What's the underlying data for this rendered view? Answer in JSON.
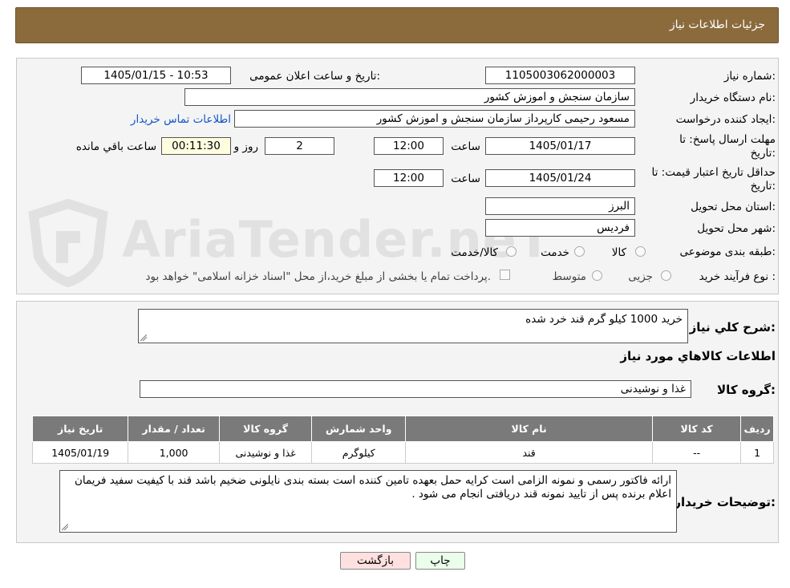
{
  "header": {
    "title": "جزئیات اطلاعات نیاز"
  },
  "form": {
    "need_number_label": "شماره نیاز:",
    "need_number": "1105003062000003",
    "announce_label": "تاریخ و ساعت اعلان عمومی:",
    "announce_value": "1405/01/15 - 10:53",
    "buyer_label": "نام دستگاه خریدار:",
    "buyer_value": "سازمان سنجش و اموزش کشور",
    "creator_label": "ایجاد کننده درخواست:",
    "creator_value": "مسعود رحیمی کارپرداز سازمان سنجش و اموزش کشور",
    "contact_link": "اطلاعات تماس خریدار",
    "deadline_label_1": "مهلت ارسال پاسخ: تا",
    "deadline_label_2": "تاریخ:",
    "deadline_date": "1405/01/17",
    "time_word": "ساعت",
    "deadline_time": "12:00",
    "days_value": "2",
    "days_word": "روز و",
    "remaining_time": "00:11:30",
    "remaining_word": "ساعت باقي مانده",
    "validity_label_1": "حداقل تاریخ اعتبار قیمت: تا",
    "validity_label_2": "تاریخ:",
    "validity_date": "1405/01/24",
    "validity_time": "12:00",
    "province_label": "استان محل تحویل:",
    "province_value": "البرز",
    "city_label": "شهر محل تحویل:",
    "city_value": "فردیس",
    "category_label": "طبقه بندی موضوعی:",
    "category_options": [
      "کالا",
      "خدمت",
      "کالا/خدمت"
    ],
    "process_label": "نوع فرآیند خرید :",
    "process_options": [
      "جزیی",
      "متوسط"
    ],
    "payment_note": "پرداخت تمام یا بخشی از مبلغ خرید،از محل \"اسناد خزانه اسلامی\" خواهد بود."
  },
  "description": {
    "label": "شرح کلي نياز:",
    "value": "خرید 1000 کیلو گرم قند خرد شده"
  },
  "goods_info": {
    "heading": "اطلاعات کالاهاي مورد نياز",
    "group_label": "گروه کالا:",
    "group_value": "غذا و نوشیدنی"
  },
  "table": {
    "headers": [
      "رديف",
      "کد کالا",
      "نام کالا",
      "واحد شمارش",
      "گروه کالا",
      "تعداد / مقدار",
      "تاریخ نیاز"
    ],
    "rows": [
      [
        "1",
        "--",
        "قند",
        "کیلوگرم",
        "غذا و نوشیدنی",
        "1,000",
        "1405/01/19"
      ]
    ]
  },
  "buyer_notes": {
    "label": "توضیحات خریدار:",
    "value": "ارائه فاکتور رسمی و نمونه الزامی است کرایه حمل بعهده تامین کننده است  بسته بندی نایلونی ضخیم باشد قند با کیفیت سفید فریمان اعلام برنده پس از تایید نمونه قند دریافتی انجام می شود ."
  },
  "buttons": {
    "print": "چاپ",
    "back": "بازگشت"
  },
  "watermark": {
    "text": "AriaTender.neT"
  },
  "colors": {
    "header": "#8b6a3c",
    "back_button": "#ffe0e0",
    "print_button": "#eaffea",
    "link": "#1155cc"
  }
}
